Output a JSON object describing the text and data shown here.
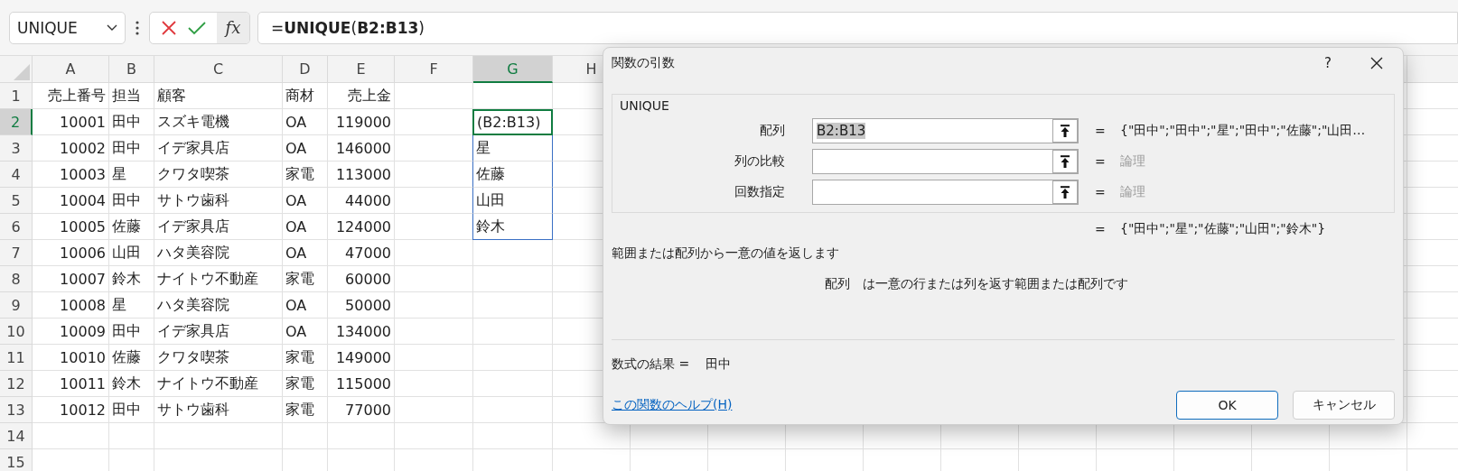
{
  "name_box": {
    "value": "UNIQUE"
  },
  "formula_bar": {
    "fx": "fx",
    "formula": "=**UNIQUE**(**B2:B13**)"
  },
  "columns": [
    {
      "label": "A",
      "kind": "number",
      "selected": false
    },
    {
      "label": "B",
      "kind": "text",
      "selected": false
    },
    {
      "label": "C",
      "kind": "text",
      "selected": false
    },
    {
      "label": "D",
      "kind": "text",
      "selected": false
    },
    {
      "label": "E",
      "kind": "number",
      "selected": false
    },
    {
      "label": "F",
      "kind": "text",
      "selected": false
    },
    {
      "label": "G",
      "kind": "text",
      "selected": true
    },
    {
      "label": "H",
      "kind": "text",
      "selected": false
    }
  ],
  "rows": [
    {
      "number": "1",
      "selected": false,
      "cells": [
        "売上番号",
        "担当",
        "顧客",
        "商材",
        "売上金"
      ]
    },
    {
      "number": "2",
      "selected": true,
      "cells": [
        "10001",
        "田中",
        "スズキ電機",
        "OA",
        "119000"
      ],
      "spill": "(B2:B13)"
    },
    {
      "number": "3",
      "selected": false,
      "cells": [
        "10002",
        "田中",
        "イデ家具店",
        "OA",
        "146000"
      ],
      "spill": "星"
    },
    {
      "number": "4",
      "selected": false,
      "cells": [
        "10003",
        "星",
        "クワタ喫茶",
        "家電",
        "113000"
      ],
      "spill": "佐藤"
    },
    {
      "number": "5",
      "selected": false,
      "cells": [
        "10004",
        "田中",
        "サトウ歯科",
        "OA",
        "44000"
      ],
      "spill": "山田"
    },
    {
      "number": "6",
      "selected": false,
      "cells": [
        "10005",
        "佐藤",
        "イデ家具店",
        "OA",
        "124000"
      ],
      "spill": "鈴木"
    },
    {
      "number": "7",
      "selected": false,
      "cells": [
        "10006",
        "山田",
        "ハタ美容院",
        "OA",
        "47000"
      ]
    },
    {
      "number": "8",
      "selected": false,
      "cells": [
        "10007",
        "鈴木",
        "ナイトウ不動産",
        "家電",
        "60000"
      ]
    },
    {
      "number": "9",
      "selected": false,
      "cells": [
        "10008",
        "星",
        "ハタ美容院",
        "OA",
        "50000"
      ]
    },
    {
      "number": "10",
      "selected": false,
      "cells": [
        "10009",
        "田中",
        "イデ家具店",
        "OA",
        "134000"
      ]
    },
    {
      "number": "11",
      "selected": false,
      "cells": [
        "10010",
        "佐藤",
        "クワタ喫茶",
        "家電",
        "149000"
      ]
    },
    {
      "number": "12",
      "selected": false,
      "cells": [
        "10011",
        "鈴木",
        "ナイトウ不動産",
        "家電",
        "115000"
      ]
    },
    {
      "number": "13",
      "selected": false,
      "cells": [
        "10012",
        "田中",
        "サトウ歯科",
        "家電",
        "77000"
      ]
    },
    {
      "number": "14",
      "selected": false
    },
    {
      "number": "15",
      "selected": false
    }
  ],
  "dialog": {
    "title": "関数の引数",
    "help": "?",
    "group": "UNIQUE",
    "arguments": [
      {
        "label": "配列",
        "value": "B2:B13",
        "value_selected": true,
        "equals": "=",
        "result": "{\"田中\";\"田中\";\"星\";\"田中\";\"佐藤\";\"山田…",
        "hint": false
      },
      {
        "label": "列の比較",
        "equals": "=",
        "result": "論理",
        "hint": true
      },
      {
        "label": "回数指定",
        "equals": "=",
        "result": "論理",
        "hint": true
      }
    ],
    "result": {
      "equals": "=",
      "value": "{\"田中\";\"星\";\"佐藤\";\"山田\";\"鈴木\"}"
    },
    "description": "範囲または配列から一意の値を返します",
    "argument_help": {
      "name": "配列",
      "text": "は一意の行または列を返す範囲または配列です"
    },
    "formula_result": {
      "label": "数式の結果 =",
      "value": "田中"
    },
    "help_link": "この関数のヘルプ(H)",
    "buttons": [
      {
        "label": "OK",
        "default": true
      },
      {
        "label": "キャンセル",
        "default": false
      }
    ]
  }
}
